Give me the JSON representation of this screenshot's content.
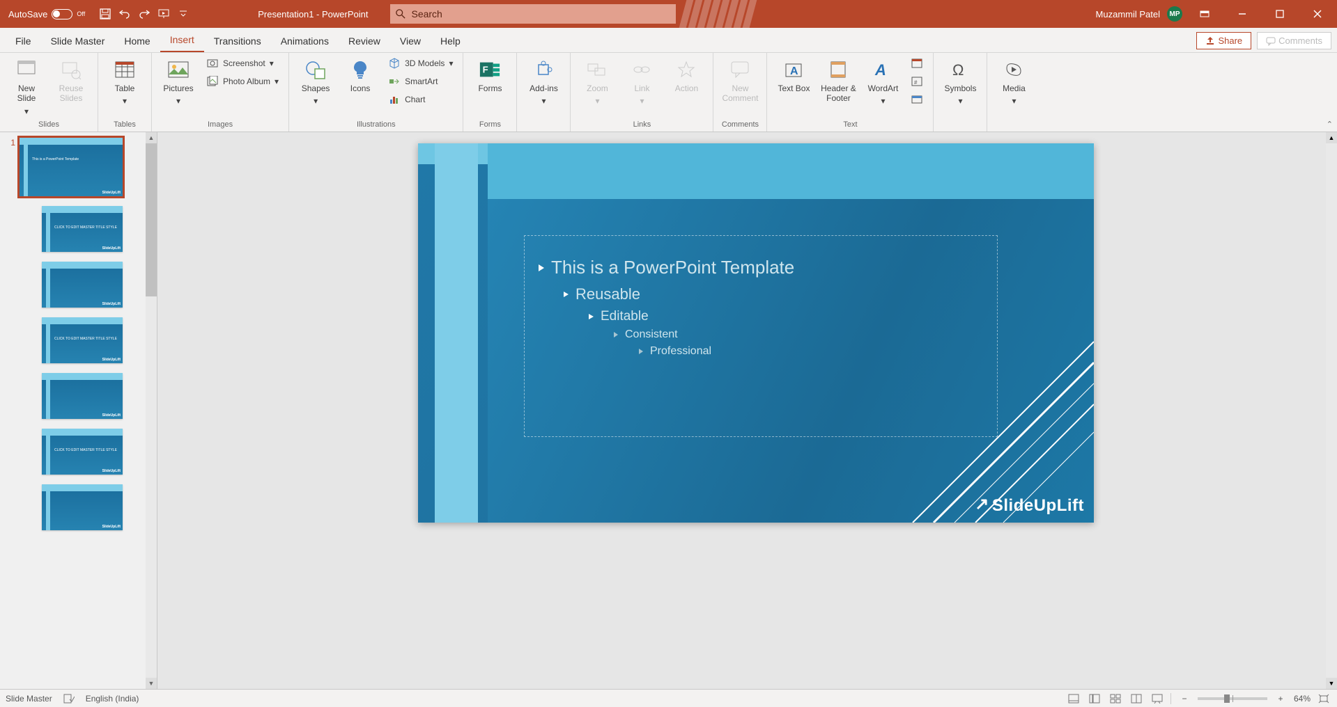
{
  "titlebar": {
    "autosave_label": "AutoSave",
    "autosave_state": "Off",
    "doc_title": "Presentation1 - PowerPoint",
    "search_placeholder": "Search",
    "user_name": "Muzammil Patel",
    "user_initials": "MP"
  },
  "tabs": {
    "file": "File",
    "slide_master": "Slide Master",
    "home": "Home",
    "insert": "Insert",
    "transitions": "Transitions",
    "animations": "Animations",
    "review": "Review",
    "view": "View",
    "help": "Help",
    "share": "Share",
    "comments": "Comments"
  },
  "ribbon": {
    "slides": {
      "new_slide": "New Slide",
      "reuse_slides": "Reuse Slides",
      "group": "Slides"
    },
    "tables": {
      "table": "Table",
      "group": "Tables"
    },
    "images": {
      "pictures": "Pictures",
      "screenshot": "Screenshot",
      "photo_album": "Photo Album",
      "group": "Images"
    },
    "illustrations": {
      "shapes": "Shapes",
      "icons": "Icons",
      "models3d": "3D Models",
      "smartart": "SmartArt",
      "chart": "Chart",
      "group": "Illustrations"
    },
    "forms": {
      "forms": "Forms",
      "group": "Forms"
    },
    "addins": {
      "addins": "Add-ins",
      "group": ""
    },
    "links": {
      "zoom": "Zoom",
      "link": "Link",
      "action": "Action",
      "group": "Links"
    },
    "comments": {
      "new_comment": "New Comment",
      "group": "Comments"
    },
    "text": {
      "text_box": "Text Box",
      "header_footer": "Header & Footer",
      "wordart": "WordArt",
      "group": "Text"
    },
    "symbols": {
      "symbols": "Symbols",
      "group": ""
    },
    "media": {
      "media": "Media",
      "group": ""
    }
  },
  "slide": {
    "line1": "This is a PowerPoint Template",
    "line2": "Reusable",
    "line3": "Editable",
    "line4": "Consistent",
    "line5": "Professional",
    "logo": "SlideUpLift"
  },
  "thumbs": {
    "number1": "1",
    "items": [
      {
        "selected": true,
        "child": false,
        "text": "This is a PowerPoint Template"
      },
      {
        "selected": false,
        "child": true,
        "text": "CLICK TO EDIT MASTER TITLE STYLE"
      },
      {
        "selected": false,
        "child": true,
        "text": ""
      },
      {
        "selected": false,
        "child": true,
        "text": "CLICK TO EDIT MASTER TITLE STYLE"
      },
      {
        "selected": false,
        "child": true,
        "text": ""
      },
      {
        "selected": false,
        "child": true,
        "text": "CLICK TO EDIT MASTER TITLE STYLE"
      },
      {
        "selected": false,
        "child": true,
        "text": ""
      }
    ]
  },
  "statusbar": {
    "mode": "Slide Master",
    "language": "English (India)",
    "zoom": "64%"
  }
}
